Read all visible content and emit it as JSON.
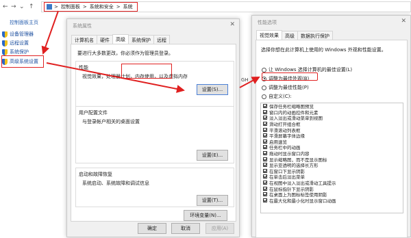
{
  "nav": {
    "back": "←",
    "forward": "→",
    "down": "⌄",
    "up": "↑",
    "breadcrumb": [
      "控制面板",
      "系统和安全",
      "系统"
    ],
    "separators": [
      ">",
      ">",
      ">"
    ]
  },
  "left_pane": {
    "home_link": "控制面板主页",
    "items": [
      "设备管理器",
      "远程设置",
      "系统保护",
      "高级系统设置"
    ]
  },
  "system_dialog": {
    "title": "系统属性",
    "close": "✕",
    "tabs": [
      "计算机名",
      "硬件",
      "高级",
      "系统保护",
      "远程"
    ],
    "active_tab": "高级",
    "admin_note": "要进行大多数更改，你必须作为管理员登录。",
    "performance": {
      "title": "性能",
      "description": "视觉效果，处理器计划，内存使用，以及虚拟内存",
      "settings_button": "设置(S)..."
    },
    "user_profiles": {
      "title": "用户配置文件",
      "description": "与登录帐户相关的桌面设置",
      "settings_button": "设置(E)..."
    },
    "startup_recovery": {
      "title": "启动和故障恢复",
      "description": "系统启动、系统故障和调试信息",
      "settings_button": "设置(T)..."
    },
    "env_button": "环境变量(N)...",
    "footer": {
      "ok": "确定",
      "cancel": "取消",
      "apply": "应用(A)"
    }
  },
  "background_text": "GH",
  "performance_dialog": {
    "title": "性能选项",
    "close": "✕",
    "tabs": [
      "视觉效果",
      "高级",
      "数据执行保护"
    ],
    "active_tab": "视觉效果",
    "intro": "选择你想在此计算机上使用的 Windows 外观和性能设置。",
    "radios": [
      {
        "label": "让 Windows 选择计算机的最佳设置(L)",
        "selected": false
      },
      {
        "label": "调整为最佳外观(B)",
        "selected": true
      },
      {
        "label": "调整为最佳性能(P)",
        "selected": false
      },
      {
        "label": "自定义(C):",
        "selected": false
      }
    ],
    "options": [
      "保存任务栏缩略图预览",
      "窗口内的动画控件和元素",
      "淡入淡出或滑动菜单到视图",
      "滑动打开组合框",
      "平滑滚动列表框",
      "平滑屏幕字体边缘",
      "启用速览",
      "任务栏中的动画",
      "拖动时显示窗口内容",
      "显示缩略图，而不是显示图标",
      "显示亚透明的选择长方形",
      "在窗口下显示阴影",
      "在单击后淡出菜单",
      "在视图中淡入淡出或滑动工具提示",
      "在鼠标指针下显示阴影",
      "在桌面上为图标标签使用阴影",
      "在最大化和最小化时显示窗口动画"
    ]
  },
  "colors": {
    "annotation": "#e02020",
    "link": "#1b4e9e",
    "dialog_bg": "#f0f0f0"
  }
}
